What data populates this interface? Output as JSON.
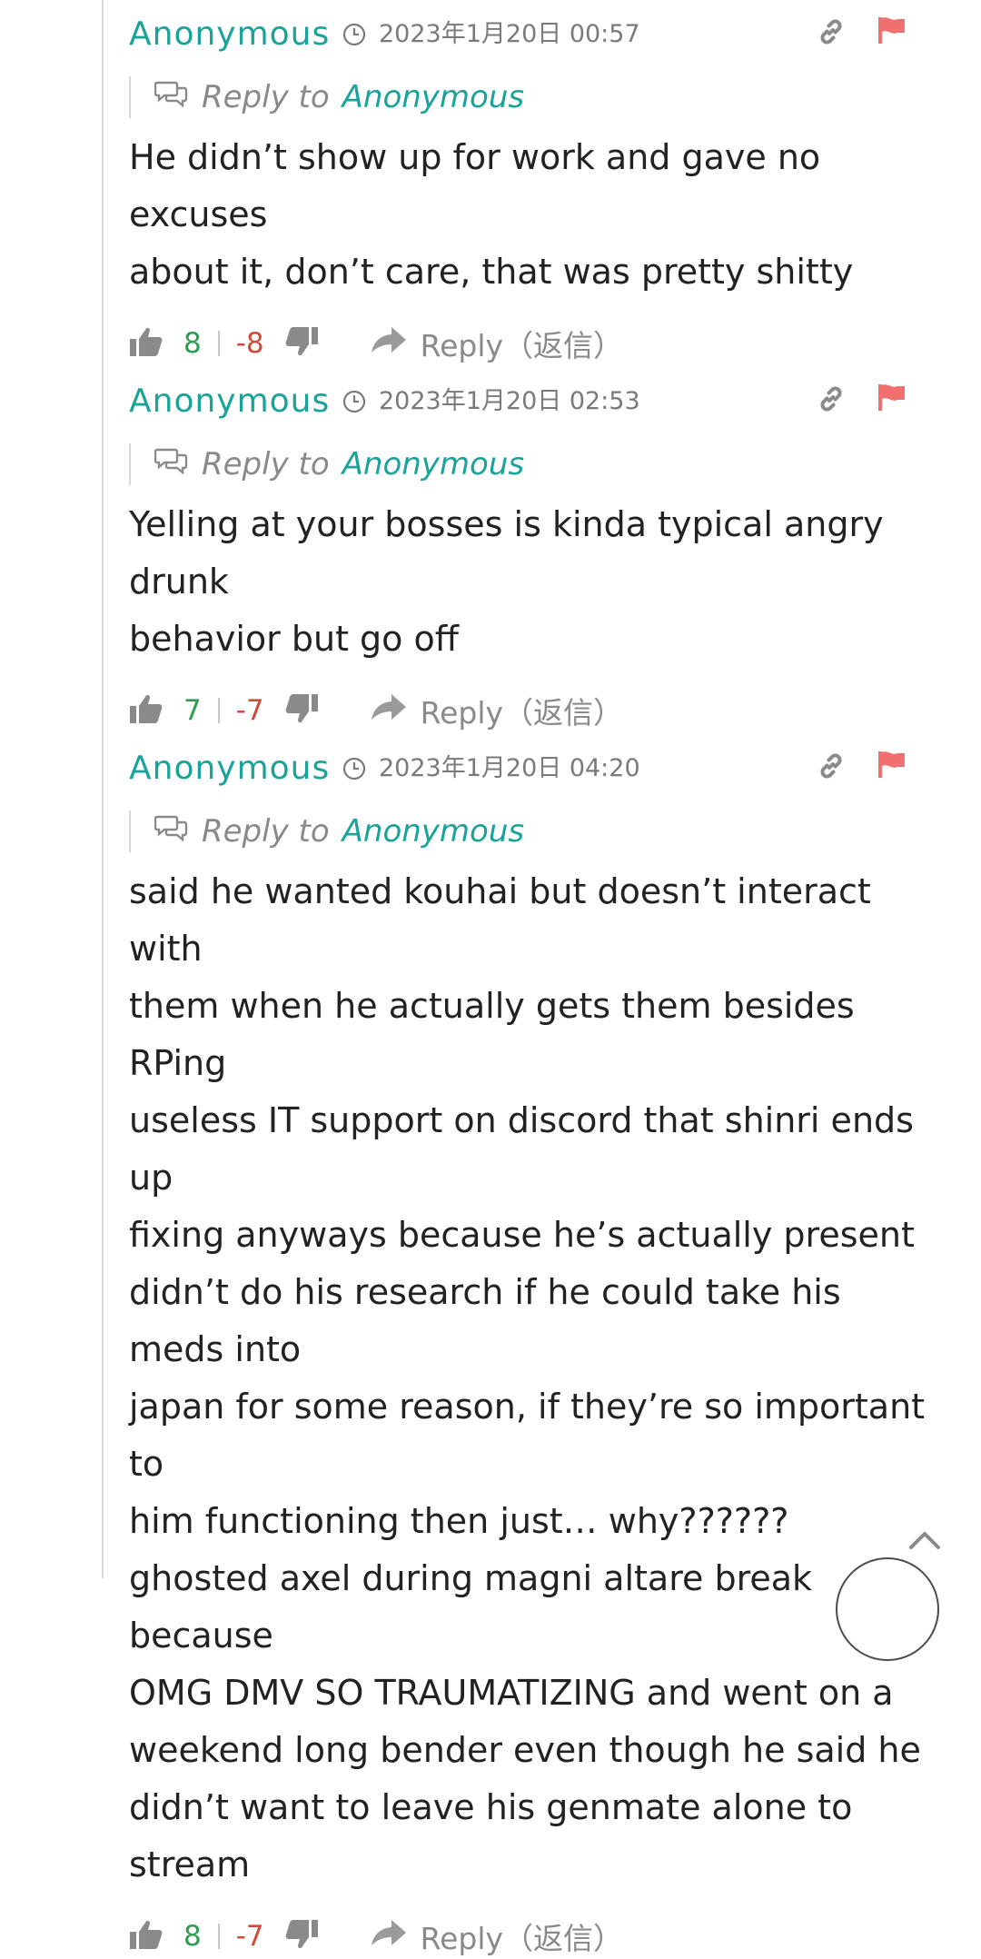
{
  "comments": [
    {
      "author": "Anonymous",
      "timestamp": "2023年1月20日 00:57",
      "reply_label": "Reply to",
      "reply_target": "Anonymous",
      "body": "He didn’t show up for work and gave no excuses\nabout it, don’t care, that was pretty shitty",
      "likes": "8",
      "dislikes": "-8",
      "reply_button": "Reply（返信）"
    },
    {
      "author": "Anonymous",
      "timestamp": "2023年1月20日 02:53",
      "reply_label": "Reply to",
      "reply_target": "Anonymous",
      "body": "Yelling at your bosses is kinda typical angry drunk\nbehavior but go off",
      "likes": "7",
      "dislikes": "-7",
      "reply_button": "Reply（返信）"
    },
    {
      "author": "Anonymous",
      "timestamp": "2023年1月20日 04:20",
      "reply_label": "Reply to",
      "reply_target": "Anonymous",
      "body": "said he wanted kouhai but doesn’t interact with\nthem when he actually gets them besides RPing\nuseless IT support on discord that shinri ends up\nfixing anyways because he’s actually present\ndidn’t do his research if he could take his meds into\njapan for some reason, if they’re so important to\nhim functioning then just… why??????\nghosted axel during magni altare break because\nOMG DMV SO TRAUMATIZING and went on a\nweekend long bender even though he said he\ndidn’t want to leave his genmate alone to stream",
      "likes": "8",
      "dislikes": "-7",
      "reply_button": "Reply（返信）"
    }
  ],
  "colors": {
    "author": "#1aa39a",
    "likes": "#2e9d4f",
    "dislikes": "#d04a3a",
    "flag": "#f07070",
    "muted": "#8a8a8a"
  },
  "icons": {
    "timestamp": "clock-icon",
    "permalink": "link-icon",
    "report": "flag-icon",
    "reply_to": "chat-bubbles-icon",
    "vote_up": "thumbs-up-icon",
    "vote_down": "thumbs-down-icon",
    "reply": "share-arrow-icon",
    "scroll_top": "chevron-up-icon"
  }
}
